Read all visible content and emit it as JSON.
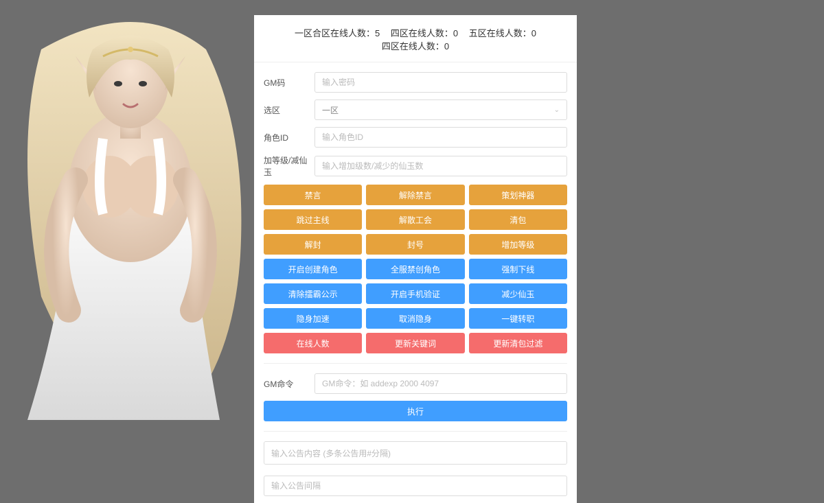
{
  "stats": [
    {
      "label": "一区合区在线人数：",
      "value": "5"
    },
    {
      "label": "四区在线人数：",
      "value": "0"
    },
    {
      "label": "五区在线人数：",
      "value": "0"
    },
    {
      "label": "四区在线人数：",
      "value": "0"
    }
  ],
  "form": {
    "gm_code_label": "GM码",
    "gm_code_placeholder": "输入密码",
    "zone_label": "选区",
    "zone_selected": "一区",
    "role_label": "角色ID",
    "role_placeholder": "输入角色ID",
    "level_label": "加等级/减仙玉",
    "level_placeholder": "输入增加级数/减少的仙玉数",
    "cmd_label": "GM命令",
    "cmd_placeholder": "GM命令：如 addexp 2000 4097",
    "exec_label": "执行",
    "announce_content_placeholder": "输入公告内容 (多条公告用#分隔)",
    "announce_interval_placeholder": "输入公告间隔"
  },
  "buttons": {
    "row1": [
      "禁言",
      "解除禁言",
      "策划神器"
    ],
    "row2": [
      "跳过主线",
      "解散工会",
      "清包"
    ],
    "row3": [
      "解封",
      "封号",
      "增加等级"
    ],
    "row4": [
      "开启创建角色",
      "全服禁创角色",
      "强制下线"
    ],
    "row5": [
      "清除擂霸公示",
      "开启手机验证",
      "减少仙玉"
    ],
    "row6": [
      "隐身加速",
      "取消隐身",
      "一键转职"
    ],
    "row7": [
      "在线人数",
      "更新关键词",
      "更新清包过滤"
    ]
  }
}
